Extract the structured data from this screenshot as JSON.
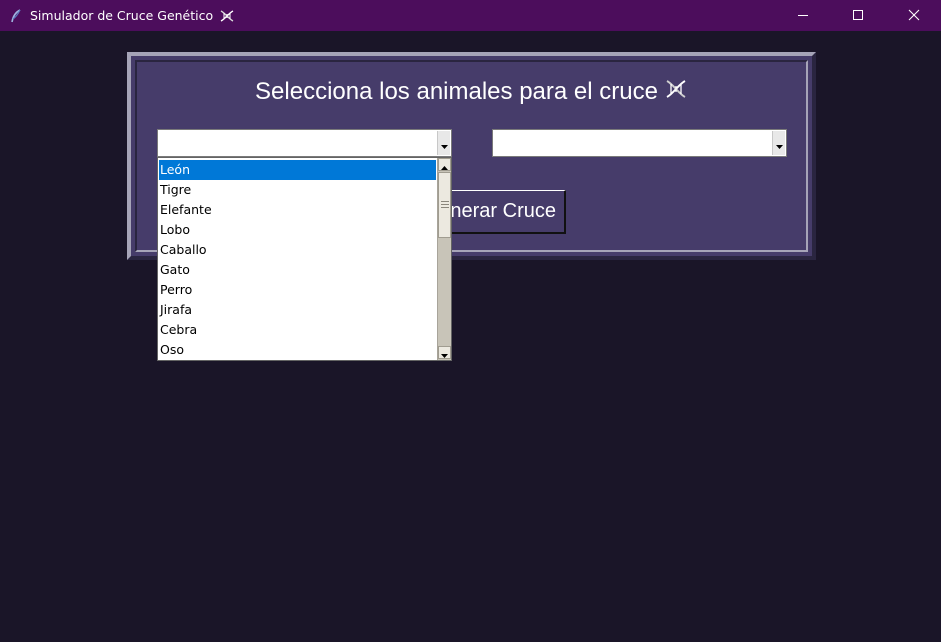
{
  "window": {
    "title": "Simulador de Cruce Genético",
    "app_icon": "feather-icon",
    "title_icon": "dna-icon",
    "controls": [
      "minimize-icon",
      "maximize-icon",
      "close-icon"
    ]
  },
  "panel": {
    "heading": "Selecciona los animales para el cruce",
    "heading_icon": "dna-icon"
  },
  "combo_left": {
    "value": ""
  },
  "combo_right": {
    "value": ""
  },
  "generate_button": {
    "label": "Generar Cruce",
    "visible_text": "nerar Cruce"
  },
  "dropdown": {
    "selected": "León",
    "items": [
      "León",
      "Tigre",
      "Elefante",
      "Lobo",
      "Caballo",
      "Gato",
      "Perro",
      "Jirafa",
      "Cebra",
      "Oso"
    ]
  },
  "colors": {
    "titlebar": "#4c0d5c",
    "background": "#1a1528",
    "panel": "#463c6a",
    "selection": "#0078d7"
  }
}
